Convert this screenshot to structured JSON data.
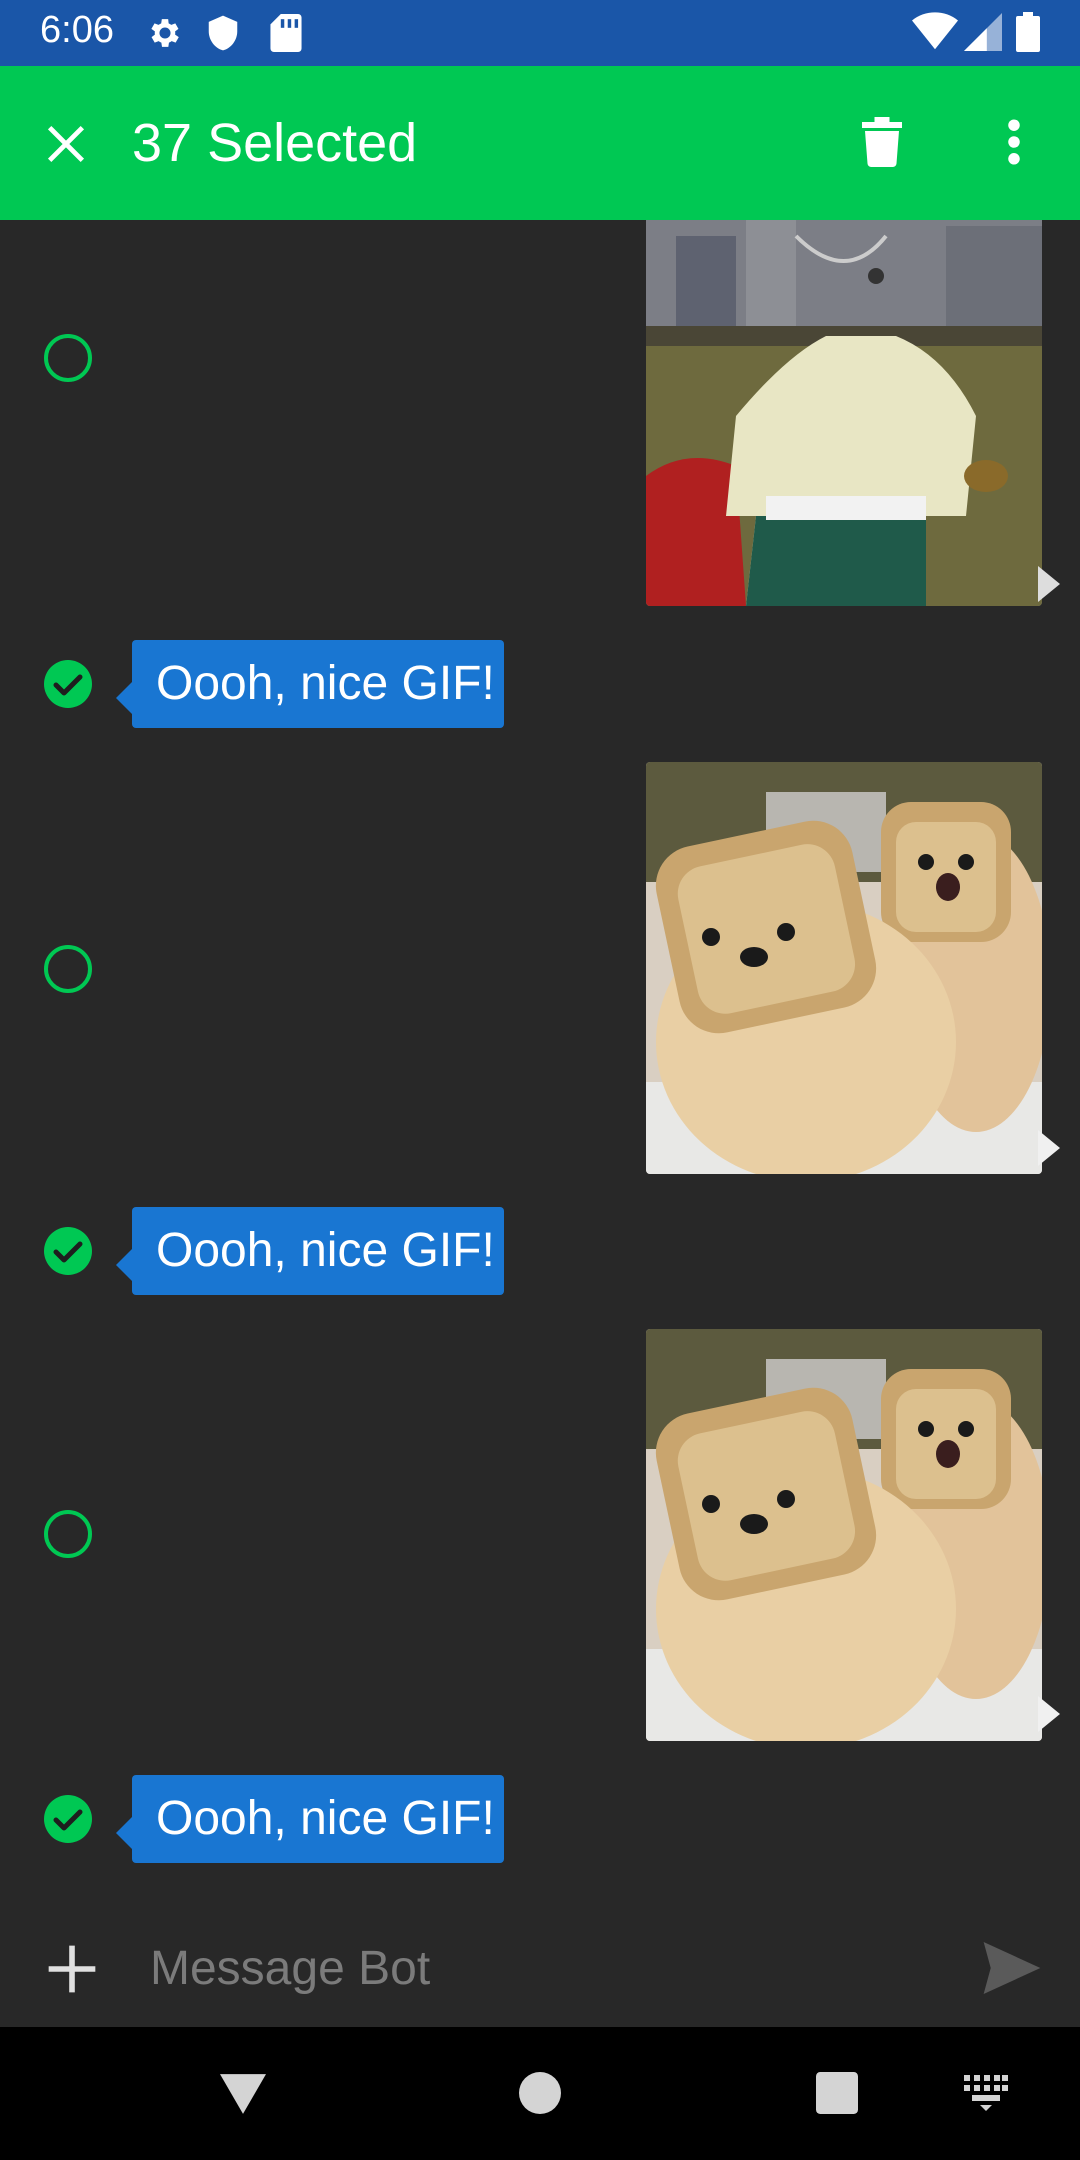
{
  "status_bar": {
    "time": "6:06",
    "icons": [
      "settings-gear-icon",
      "shield-icon",
      "sd-card-icon",
      "wifi-icon",
      "cell-signal-icon",
      "battery-icon"
    ]
  },
  "app_bar": {
    "title": "37 Selected",
    "close_icon": "close-icon",
    "delete_icon": "trash-icon",
    "overflow_icon": "more-vert-icon",
    "color": "#00c853"
  },
  "messages": [
    {
      "type": "gif",
      "direction": "outgoing",
      "selected": false,
      "image": "cartoon-woman-gif"
    },
    {
      "type": "text",
      "direction": "incoming",
      "selected": true,
      "text": "Oooh, nice GIF!"
    },
    {
      "type": "gif",
      "direction": "outgoing",
      "selected": false,
      "image": "bread-dogs-gif"
    },
    {
      "type": "text",
      "direction": "incoming",
      "selected": true,
      "text": "Oooh, nice GIF!"
    },
    {
      "type": "gif",
      "direction": "outgoing",
      "selected": false,
      "image": "bread-dogs-gif"
    },
    {
      "type": "text",
      "direction": "incoming",
      "selected": true,
      "text": "Oooh, nice GIF!"
    }
  ],
  "composer": {
    "placeholder": "Message Bot",
    "add_icon": "plus-icon",
    "send_icon": "send-icon"
  },
  "nav_bar": {
    "icons": [
      "back-icon",
      "home-icon",
      "recents-icon",
      "keyboard-icon"
    ]
  },
  "colors": {
    "background": "#282828",
    "status_bar": "#1a56a8",
    "accent": "#00c853",
    "incoming_bubble": "#1976d2"
  }
}
